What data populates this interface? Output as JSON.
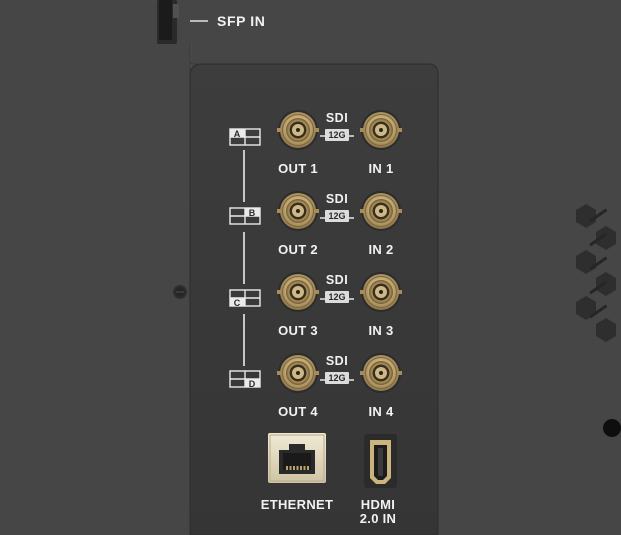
{
  "labels": {
    "sfp_in": "SFP IN",
    "ethernet": "ETHERNET",
    "hdmi_line1": "HDMI",
    "hdmi_line2": "2.0 IN"
  },
  "sdi_rows": [
    {
      "quadrant": "A",
      "sdi": "SDI",
      "badge": "12G",
      "out": "OUT 1",
      "in": "IN 1"
    },
    {
      "quadrant": "B",
      "sdi": "SDI",
      "badge": "12G",
      "out": "OUT 2",
      "in": "IN 2"
    },
    {
      "quadrant": "C",
      "sdi": "SDI",
      "badge": "12G",
      "out": "OUT 3",
      "in": "IN 3"
    },
    {
      "quadrant": "D",
      "sdi": "SDI",
      "badge": "12G",
      "out": "OUT 4",
      "in": "IN 4"
    }
  ],
  "colors": {
    "chassis": "#464646",
    "panel": "#383838",
    "connector_gold": "#c9b07a",
    "label_text": "#f2f2f2"
  }
}
